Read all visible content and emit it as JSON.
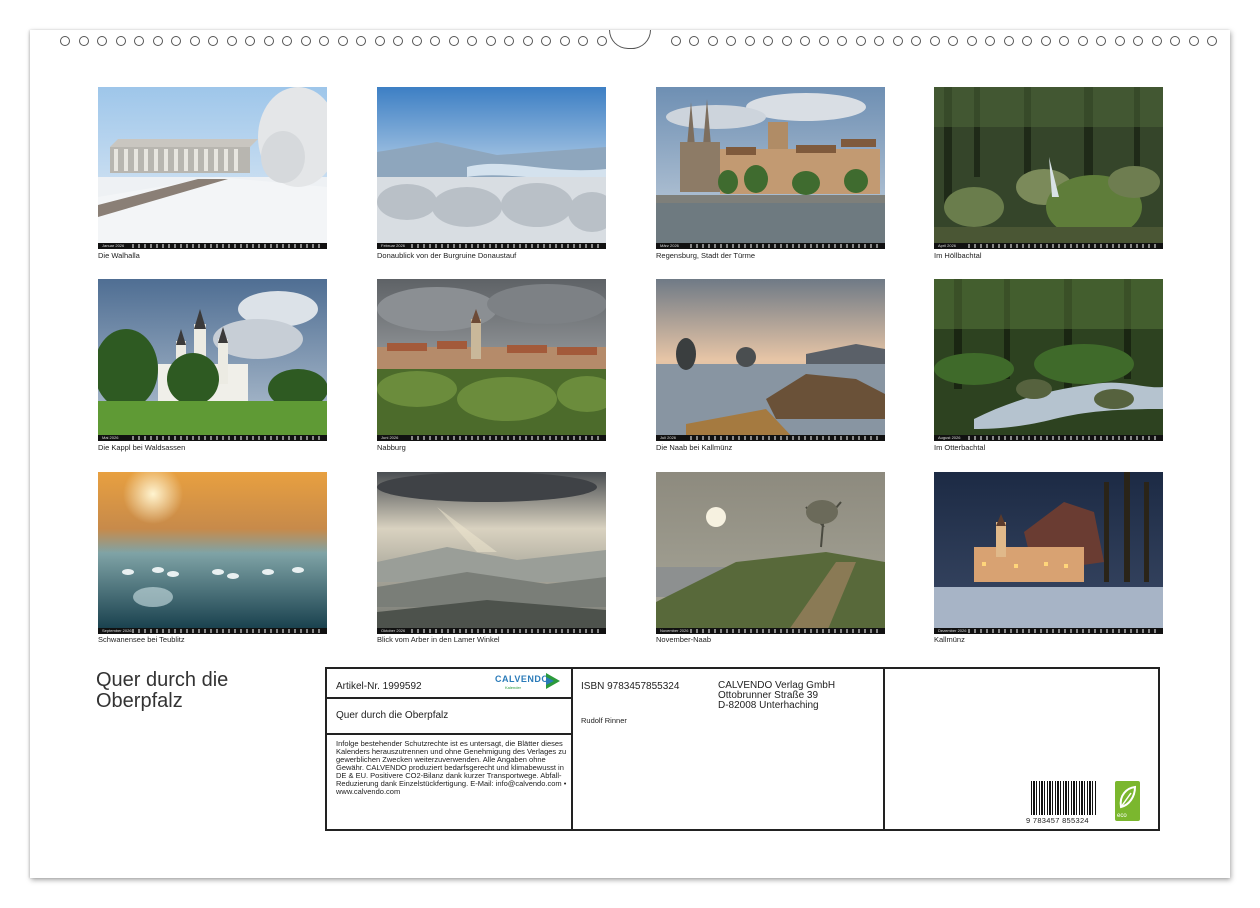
{
  "months": [
    {
      "strip": "Januar 2026",
      "caption": "Die Walhalla"
    },
    {
      "strip": "Februar 2026",
      "caption": "Donaublick von der Burgruine Donaustauf"
    },
    {
      "strip": "März 2026",
      "caption": "Regensburg, Stadt der Türme"
    },
    {
      "strip": "April 2026",
      "caption": "Im Höllbachtal"
    },
    {
      "strip": "Mai 2026",
      "caption": "Die Kappl bei Waldsassen"
    },
    {
      "strip": "Juni 2026",
      "caption": "Nabburg"
    },
    {
      "strip": "Juli 2026",
      "caption": "Die Naab bei Kallmünz"
    },
    {
      "strip": "August 2026",
      "caption": "Im Otterbachtal"
    },
    {
      "strip": "September 2026",
      "caption": "Schwanensee bei Teublitz"
    },
    {
      "strip": "Oktober 2026",
      "caption": "Blick vom Arber in den Lamer Winkel"
    },
    {
      "strip": "November 2026",
      "caption": "November-Naab"
    },
    {
      "strip": "Dezember 2026",
      "caption": "Kallmünz"
    }
  ],
  "cover_title": "Quer durch die Oberpfalz",
  "info": {
    "article": "Artikel-Nr. 1999592",
    "logo": "CALVENDO",
    "logo_sub": "Kalender",
    "title": "Quer durch die Oberpfalz",
    "legal": "Infolge bestehender Schutzrechte ist es untersagt, die Blätter dieses Kalenders herauszutrennen und ohne Genehmigung des Verlages zu gewerblichen Zwecken weiterzuverwenden. Alle Angaben ohne Gewähr. CALVENDO produziert bedarfsgerecht und klimabewusst in DE & EU. Positivere CO2-Bilanz dank kurzer Transportwege. Abfall-Reduzierung dank Einzelstückfertigung. E-Mail: info@calvendo.com • www.calvendo.com",
    "isbn": "ISBN 9783457855324",
    "author": "Rudolf Rinner",
    "publisher_name": "CALVENDO Verlag GmbH",
    "publisher_street": "Ottobrunner Straße 39",
    "publisher_city": "D-82008 Unterhaching",
    "barcode_number": "9 783457 855324",
    "eco_label": "eco"
  }
}
